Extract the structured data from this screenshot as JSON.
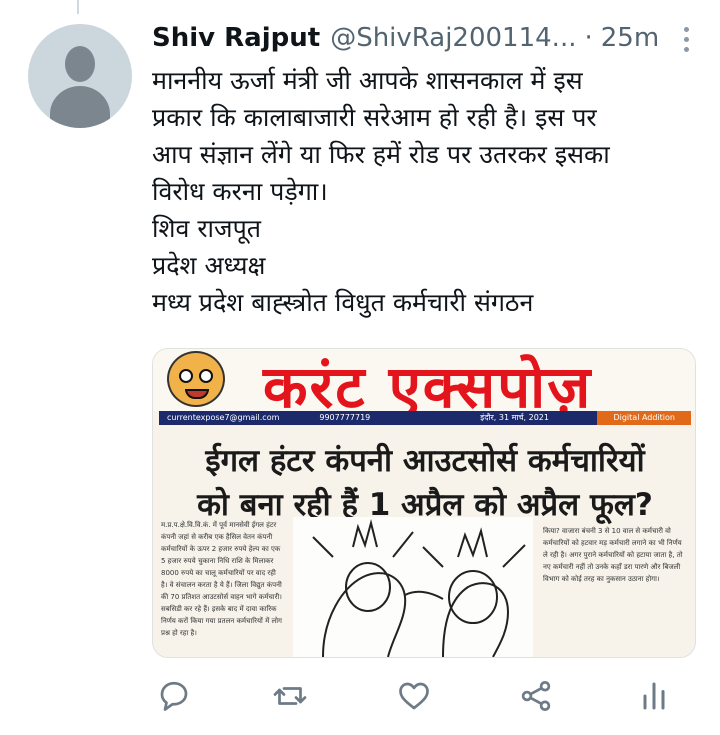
{
  "tweet": {
    "display_name": "Shiv Rajput",
    "handle": "@ShivRaj200114...",
    "separator": "·",
    "time": "25m",
    "text_lines": [
      "माननीय ऊर्जा मंत्री जी आपके शासनकाल में इस",
      "प्रकार कि कालाबाजारी सरेआम हो रही है। इस पर",
      "आप संज्ञान लेंगे या फिर हमें रोड पर उतरकर इसका",
      "विरोध करना पड़ेगा।",
      "शिव राजपूत",
      "प्रदेश अध्यक्ष",
      "मध्य प्रदेश बाह्स्त्रोत विधुत कर्मचारी संगठन"
    ]
  },
  "media": {
    "masthead": "करंट एक्सपोज़",
    "info_bar": {
      "email": "currentexpose7@gmail.com",
      "phone": "9907777719",
      "dateline": "इंदौर, 31 मार्च, 2021",
      "edition": "Digital Addition"
    },
    "headline_lines": [
      "ईगल हंटर कंपनी आउटसोर्स कर्मचारियों",
      "को बना रही हैं 1 अप्रैल को अप्रैल फूल?"
    ],
    "left_column": "म.प्र.प.क्षे.वि.वि.कं. में पूर्व मानसेवी ईगल हंटर कंपनी जहां से करीब एक हैसिल वेतन कंपनी कर्मचारियों के ऊपर 2 हजार रुपये हेल्प का एक 5 हजार रुपये चुकाना निधि राशि के मिलाकर 8000 रुपये का चालू कर्मचारियों पर वाद रही है। वे संचालन करता है ये हैं। जिला विद्युत कंपनी की 70 प्रतिशत आउटसोर्स वाहन भागे कर्मचारी। सबसिडी कर रहे हैं। इसके बाद में दावा कारिक निर्णय करों किया गया प्रतलन कर्मचारियों में लोग प्रश्न हो रहा है।",
    "right_column": "किया? वाजारा बंचनी 3 से 10 वाल से कर्मचारी वो कर्मचारियों को हटवार मड़ कर्मचारी लगाने का भी निर्णय ले रही है। अगर पुराने कर्मचारियों को हटाया जाता है, तो नए कर्मचारी नहीं तो उनके कहाँ डरा पारणे और बिजली विभाग को कोई तरह का नुकसान उठाना होगा।"
  }
}
